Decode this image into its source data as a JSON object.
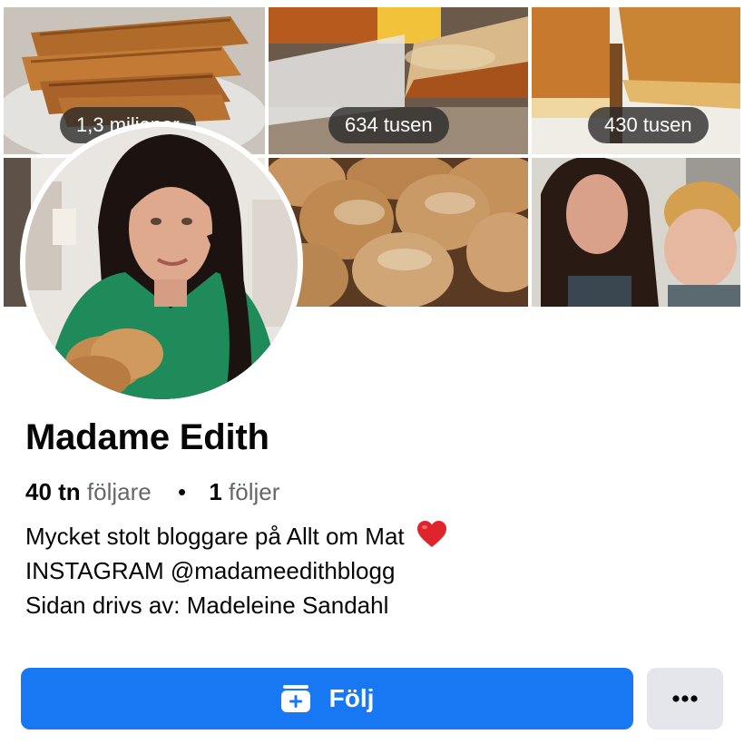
{
  "cover": {
    "tiles": [
      {
        "views": "1,3 miljoner"
      },
      {
        "views": "634 tusen"
      },
      {
        "views": "430 tusen"
      }
    ]
  },
  "profile": {
    "name": "Madame Edith",
    "followers_count": "40 tn",
    "followers_label": "följare",
    "separator": "•",
    "following_count": "1",
    "following_label": "följer",
    "bio": {
      "line1": "Mycket stolt bloggare på Allt om Mat",
      "line1_emoji": "heart-emoji",
      "line2": "INSTAGRAM @madameedithblogg",
      "line3": "Sidan drivs av: Madeleine Sandahl"
    }
  },
  "actions": {
    "follow_label": "Följ",
    "follow_icon": "add-to-list-icon",
    "more_icon": "more-dots-icon"
  },
  "colors": {
    "accent": "#1877f2",
    "secondary_button": "#e4e6eb",
    "muted_text": "#65676b",
    "text": "#050505"
  }
}
